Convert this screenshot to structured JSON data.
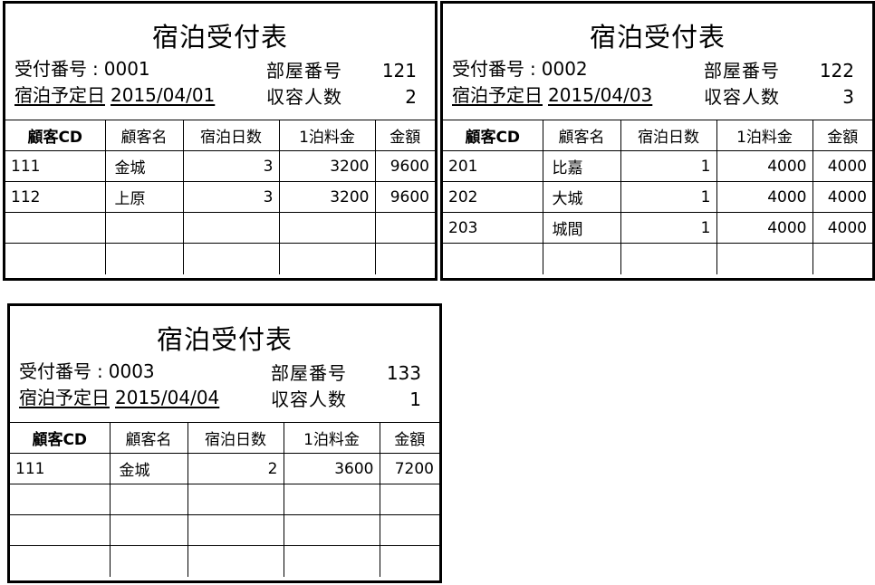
{
  "cards": [
    {
      "title": "宿泊受付表",
      "receipt_label": "受付番号",
      "receipt_no": "0001",
      "date_label": "宿泊予定日",
      "date": "2015/04/01",
      "room_label": "部屋番号",
      "room_no": "121",
      "guests_label": "収容人数",
      "guests": "2",
      "columns": [
        "顧客CD",
        "顧客名",
        "宿泊日数",
        "1泊料金",
        "金額"
      ],
      "rows": [
        [
          "111",
          "金城",
          "3",
          "3200",
          "9600"
        ],
        [
          "112",
          "上原",
          "3",
          "3200",
          "9600"
        ],
        [
          "",
          "",
          "",
          "",
          ""
        ],
        [
          "",
          "",
          "",
          "",
          ""
        ]
      ]
    },
    {
      "title": "宿泊受付表",
      "receipt_label": "受付番号",
      "receipt_no": "0002",
      "date_label": "宿泊予定日",
      "date": "2015/04/03",
      "room_label": "部屋番号",
      "room_no": "122",
      "guests_label": "収容人数",
      "guests": "3",
      "columns": [
        "顧客CD",
        "顧客名",
        "宿泊日数",
        "1泊料金",
        "金額"
      ],
      "rows": [
        [
          "201",
          "比嘉",
          "1",
          "4000",
          "4000"
        ],
        [
          "202",
          "大城",
          "1",
          "4000",
          "4000"
        ],
        [
          "203",
          "城間",
          "1",
          "4000",
          "4000"
        ],
        [
          "",
          "",
          "",
          "",
          ""
        ]
      ]
    },
    {
      "title": "宿泊受付表",
      "receipt_label": "受付番号",
      "receipt_no": "0003",
      "date_label": "宿泊予定日",
      "date": "2015/04/04",
      "room_label": "部屋番号",
      "room_no": "133",
      "guests_label": "収容人数",
      "guests": "1",
      "columns": [
        "顧客CD",
        "顧客名",
        "宿泊日数",
        "1泊料金",
        "金額"
      ],
      "rows": [
        [
          "111",
          "金城",
          "2",
          "3600",
          "7200"
        ],
        [
          "",
          "",
          "",
          "",
          ""
        ],
        [
          "",
          "",
          "",
          "",
          ""
        ],
        [
          "",
          "",
          "",
          "",
          ""
        ]
      ]
    }
  ]
}
